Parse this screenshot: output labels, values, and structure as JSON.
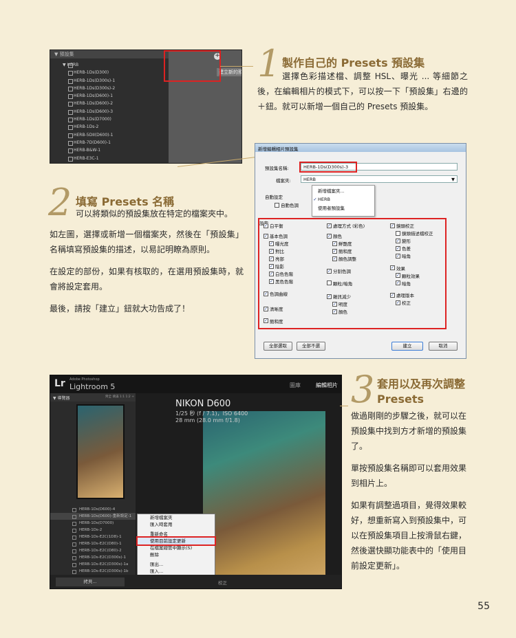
{
  "page_number": "55",
  "colors": {
    "accent": "#b29a66",
    "title": "#8a6a34",
    "highlight": "#dd2222",
    "background": "#f6eed7"
  },
  "step1": {
    "number": "1",
    "title": "製作自己的 Presets 預設集",
    "body": "選擇色彩描述檔、調整 HSL、曝光 ... 等細節之後，在編輯相片的模式下，可以按一下「預設集」右邊的＋鈕。就可以新增一個自己的 Presets 預設集。"
  },
  "step2": {
    "number": "2",
    "title": "填寫 Presets 名稱",
    "subtitle": "可以將類似的預設集放在特定的檔案夾中。",
    "paragraphs": [
      "如左圖，選擇或新增一個檔案夾，然後在「預設集」名稱填寫預設集的描述，以易記明瞭為原則。",
      "在設定的部份，如果有核取的，在選用預設集時，就會將設定套用。",
      "最後，請按「建立」鈕就大功告成了！"
    ]
  },
  "step3": {
    "number": "3",
    "title": "套用以及再次調整 Presets",
    "paragraphs": [
      "做過剛剛的步驟之後，就可以在預設集中找到方才新增的預設集了。",
      "單按預設集名稱即可以套用效果到相片上。",
      "如果有調整過項目，覺得效果較好，想重新寫入到預設集中，可以在預設集項目上按滑鼠右鍵，然後選快顯功能表中的「使用目前設定更新」。"
    ]
  },
  "screenshot1": {
    "panel_title": "▼ 預設集",
    "tooltip": "建立新的預設集",
    "plus": "+",
    "items": [
      "▼ HERB",
      "HERB-1Ds(D300)",
      "HERB-1Ds(D300s)-1",
      "HERB-1Ds(D300s)-2",
      "HERB-1Ds(D600)-1",
      "HERB-1Ds(D600)-2",
      "HERB-1Ds(D600)-3",
      "HERB-1Ds(D7000)",
      "HERB-1Ds-2",
      "HERB-5DII(D600)-1",
      "HERB-7D(D600)-1",
      "HERB-B&W-1",
      "HERB-E3C-1"
    ]
  },
  "dialog": {
    "title": "新增編輯相片預設集",
    "name_label": "預設集名稱:",
    "name_value": "HERB-1Ds(D300s)-3",
    "folder_label": "檔案夾:",
    "folder_value": "HERB",
    "menu": [
      "新增檔案夾...",
      "HERB",
      "使用者預設集"
    ],
    "menu_check": "✓",
    "auto_label": "自動設定",
    "auto_option": "自動色調",
    "settings_label": "設定",
    "col1": [
      "白平衡",
      "基本色調",
      "曝光度",
      "對比",
      "亮部",
      "陰影",
      "白色色階",
      "黑色色階",
      "色調曲線",
      "清晰度",
      "飽和度"
    ],
    "col2": [
      "處理方式 (彩色)",
      "顏色",
      "鮮艷度",
      "飽和度",
      "顏色調整",
      "分割色調",
      "顆粒/暗角",
      "雜訊減少",
      "明度",
      "顏色"
    ],
    "col3": [
      "鏡頭校正",
      "鏡頭描述檔校正",
      "變形",
      "色差",
      "暗角",
      "效果",
      "顆粒效果",
      "暗角",
      "處理版本",
      "校正"
    ],
    "btn_select_all": "全部選取",
    "btn_select_none": "全部不選",
    "btn_create": "建立",
    "btn_cancel": "取消"
  },
  "screenshot3": {
    "app_small": "Adobe Photoshop",
    "app_name": "Lightroom 5",
    "logo": "Lr",
    "modules": [
      "圖庫",
      "編輯相片"
    ],
    "navigator": "▼ 導覽器",
    "nav_zoom": "齊全  填滿  1:1  1:2 ÷",
    "camera": "NIKON D600",
    "exposure": "1/25 秒 (f / 7.1)，ISO 6400",
    "focal": "28 mm (28.0 mm f/1.8)",
    "preset_items": [
      "HERB-1Ds(D600)-4",
      "HERB-1Ds(D600)-重新設定-1",
      "HERB-1Ds(D7000)",
      "HERB-1Ds-2",
      "HERB-1Ds-E2C(1D8)-1",
      "HERB-1Ds-E2C(D80)-1",
      "HERB-1Ds-E2C(D80)-2",
      "HERB-1Ds-E2C(D300s)-1",
      "HERB-1Ds-E2C(D300s)-1a",
      "HERB-1Ds-E2C(D300s)-1b"
    ],
    "context_menu": [
      "新增檔案夾",
      "匯入時套用",
      "重新命名",
      "使用目前設定更新",
      "在檔案總管中顯示(S)",
      "刪除",
      "匯出...",
      "匯入..."
    ],
    "highlight_index": 3,
    "bottom_btn": "拷貝...",
    "bottom_right": "校正"
  }
}
